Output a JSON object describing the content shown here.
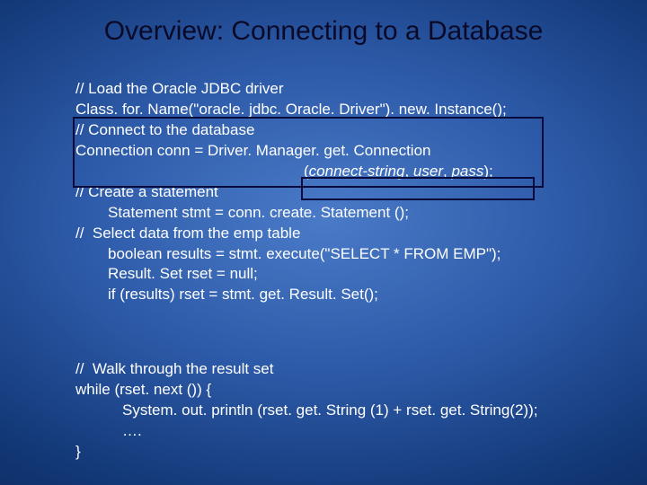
{
  "title": "Overview: Connecting to a Database",
  "lines": {
    "l1": "// Load the Oracle JDBC driver",
    "l2": "Class. for. Name(\"oracle. jdbc. Oracle. Driver\"). new. Instance();",
    "l3": "// Connect to the database",
    "l4": "Connection conn = Driver. Manager. get. Connection",
    "l5a": "(",
    "l5b": "connect-string",
    "l5c": ", ",
    "l5d": "user",
    "l5e": ", ",
    "l5f": "pass",
    "l5g": ");",
    "l6": "// Create a statement",
    "l7": "Statement stmt = conn. create. Statement ();",
    "l8": "//  Select data from the emp table",
    "l9": "boolean results = stmt. execute(\"SELECT * FROM EMP\");",
    "l10": "Result. Set rset = null;",
    "l11": "if (results) rset = stmt. get. Result. Set();",
    "w1": "//  Walk through the result set",
    "w2": "while (rset. next ()) {",
    "w3": "System. out. println (rset. get. String (1) + rset. get. String(2));",
    "w4": "….",
    "w5": "}"
  }
}
